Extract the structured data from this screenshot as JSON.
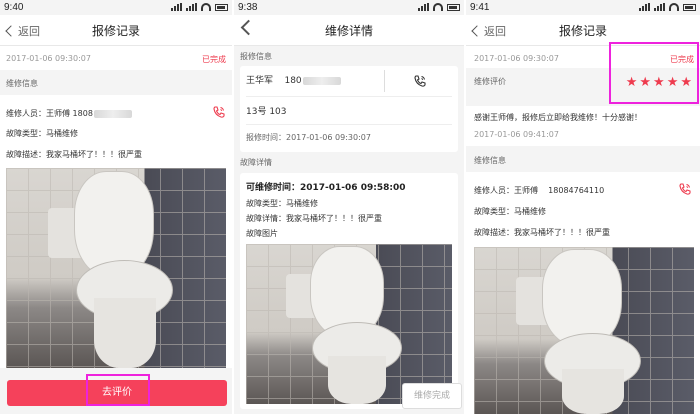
{
  "panel1": {
    "status_time": "9:40",
    "back_label": "返回",
    "title": "报修记录",
    "datetime": "2017-01-06 09:30:07",
    "status": "已完成",
    "section": "维修信息",
    "repairer_label": "维修人员：王师傅",
    "repairer_phone": "1808",
    "fault_type": "故障类型：马桶维修",
    "fault_desc": "故障描述：我家马桶坏了！！！很严重",
    "button": "去评价"
  },
  "panel2": {
    "status_time": "9:38",
    "title": "维修详情",
    "section_report": "报修信息",
    "name": "王华军",
    "phone": "180",
    "address": "13号 103",
    "report_time": "报修时间：2017-01-06 09:30:07",
    "section_fault": "故障详情",
    "available_time": "可维修时间：2017-01-06 09:58:00",
    "fault_type": "故障类型：马桶维修",
    "fault_detail": "故障详情：我家马桶坏了！！！很严重",
    "fault_image": "故障图片",
    "button": "维修完成"
  },
  "panel3": {
    "status_time": "9:41",
    "back_label": "返回",
    "title": "报修记录",
    "datetime": "2017-01-06 09:30:07",
    "status": "已完成",
    "rating_label": "维修评价",
    "rating": 5,
    "comment": "感谢王师傅，报修后立即给我维修！十分感谢！",
    "comment_time": "2017-01-06 09:41:07",
    "section": "维修信息",
    "repairer_label": "维修人员：王师傅",
    "repairer_phone": "18084764110",
    "fault_type": "故障类型：马桶维修",
    "fault_desc": "故障描述：我家马桶坏了！！！很严重"
  },
  "colors": {
    "accent": "#f5415b",
    "highlight": "#ee22dd",
    "status": "#ee3b4e"
  }
}
